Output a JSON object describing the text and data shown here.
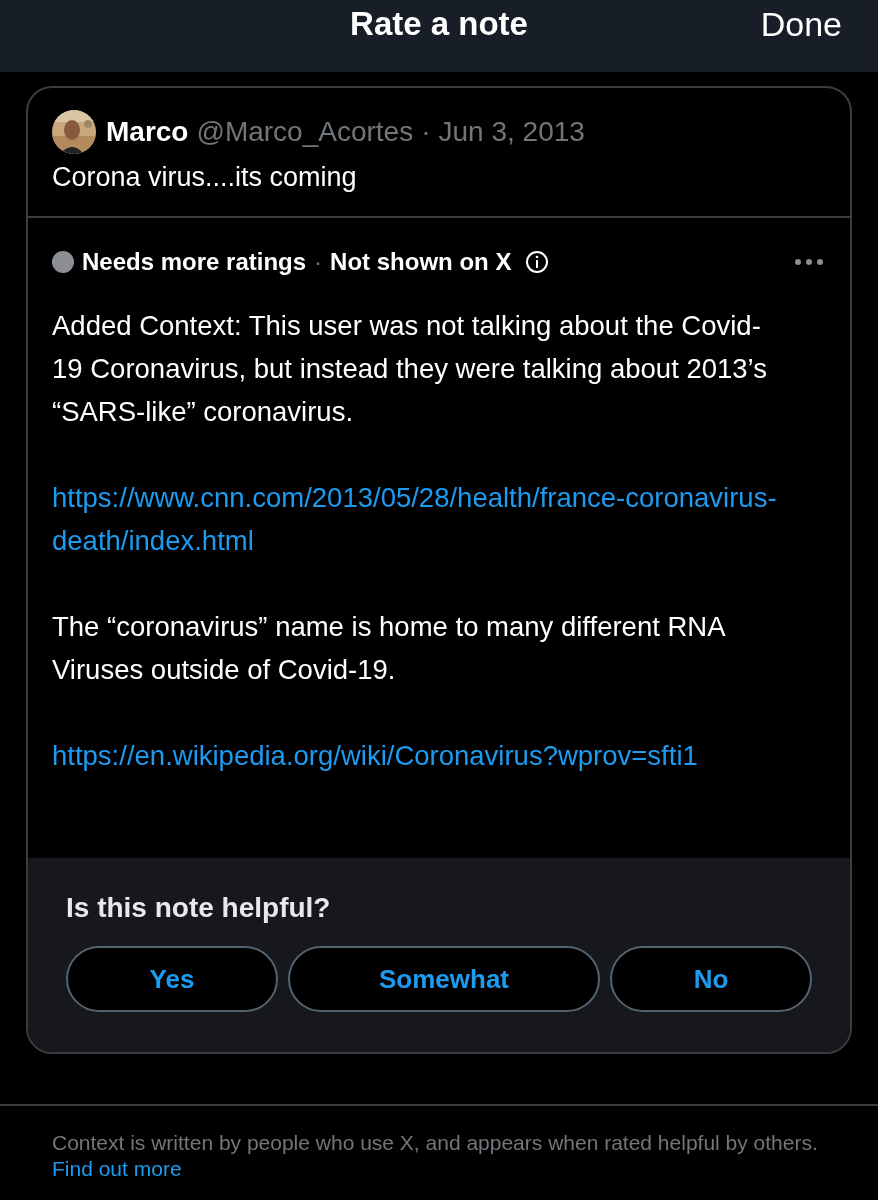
{
  "header": {
    "title": "Rate a note",
    "done": "Done"
  },
  "tweet": {
    "name": "Marco",
    "handle": "@Marco_Acortes",
    "separator": "·",
    "date": "Jun 3, 2013",
    "text": "Corona virus....its coming"
  },
  "note": {
    "status": "Needs more ratings",
    "separator": "·",
    "visibility": "Not shown on X",
    "color": "#8b8f94",
    "paragraphs": [
      {
        "kind": "text",
        "text": "Added Context: This user was not talking about the Covid-19 Coronavirus, but instead they were talking about 2013’s “SARS-like” coronavirus."
      },
      {
        "kind": "link",
        "text": "https://www.cnn.com/2013/05/28/health/france-coronavirus-death/index.html"
      },
      {
        "kind": "text",
        "text": "The “coronavirus” name is home to many different RNA Viruses outside of Covid-19."
      },
      {
        "kind": "link",
        "text": "https://en.wikipedia.org/wiki/Coronavirus?wprov=sfti1"
      }
    ]
  },
  "rating": {
    "question": "Is this note helpful?",
    "options": [
      {
        "label": "Yes",
        "selected": false
      },
      {
        "label": "Somewhat",
        "selected": false
      },
      {
        "label": "No",
        "selected": false
      }
    ]
  },
  "footer": {
    "text": "Context is written by people who use X, and appears when rated helpful by others.",
    "link": "Find out more"
  }
}
